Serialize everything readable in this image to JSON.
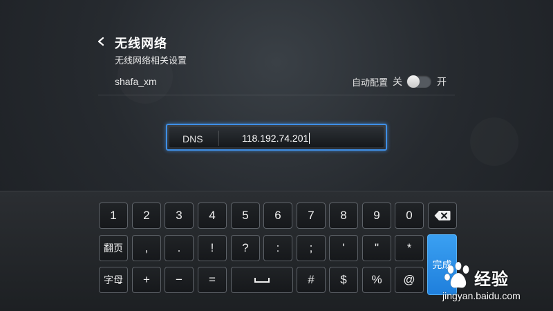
{
  "header": {
    "title": "无线网络",
    "subtitle": "无线网络相关设置",
    "back_icon": "chevron-left-icon"
  },
  "network": {
    "ssid": "shafa_xm",
    "auto_config_label": "自动配置",
    "off_label": "关",
    "on_label": "开",
    "auto_config_enabled": false
  },
  "dns_field": {
    "label": "DNS",
    "value": "118.192.74.201"
  },
  "keyboard": {
    "row1": [
      "1",
      "2",
      "3",
      "4",
      "5",
      "6",
      "7",
      "8",
      "9",
      "0"
    ],
    "row1_last_icon": "backspace-icon",
    "row2": [
      "翻页",
      ",",
      ".",
      "!",
      "?",
      ":",
      ";",
      "'",
      "\"",
      "*"
    ],
    "row3": [
      "字母",
      "+",
      "−",
      "=",
      "space",
      "#",
      "$",
      "%",
      "@"
    ],
    "done_label": "完成"
  },
  "watermark": {
    "brand": "经验",
    "url": "jingyan.baidu.com"
  },
  "colors": {
    "accent": "#2b8ae6",
    "done_key": "#2a8ee8"
  }
}
